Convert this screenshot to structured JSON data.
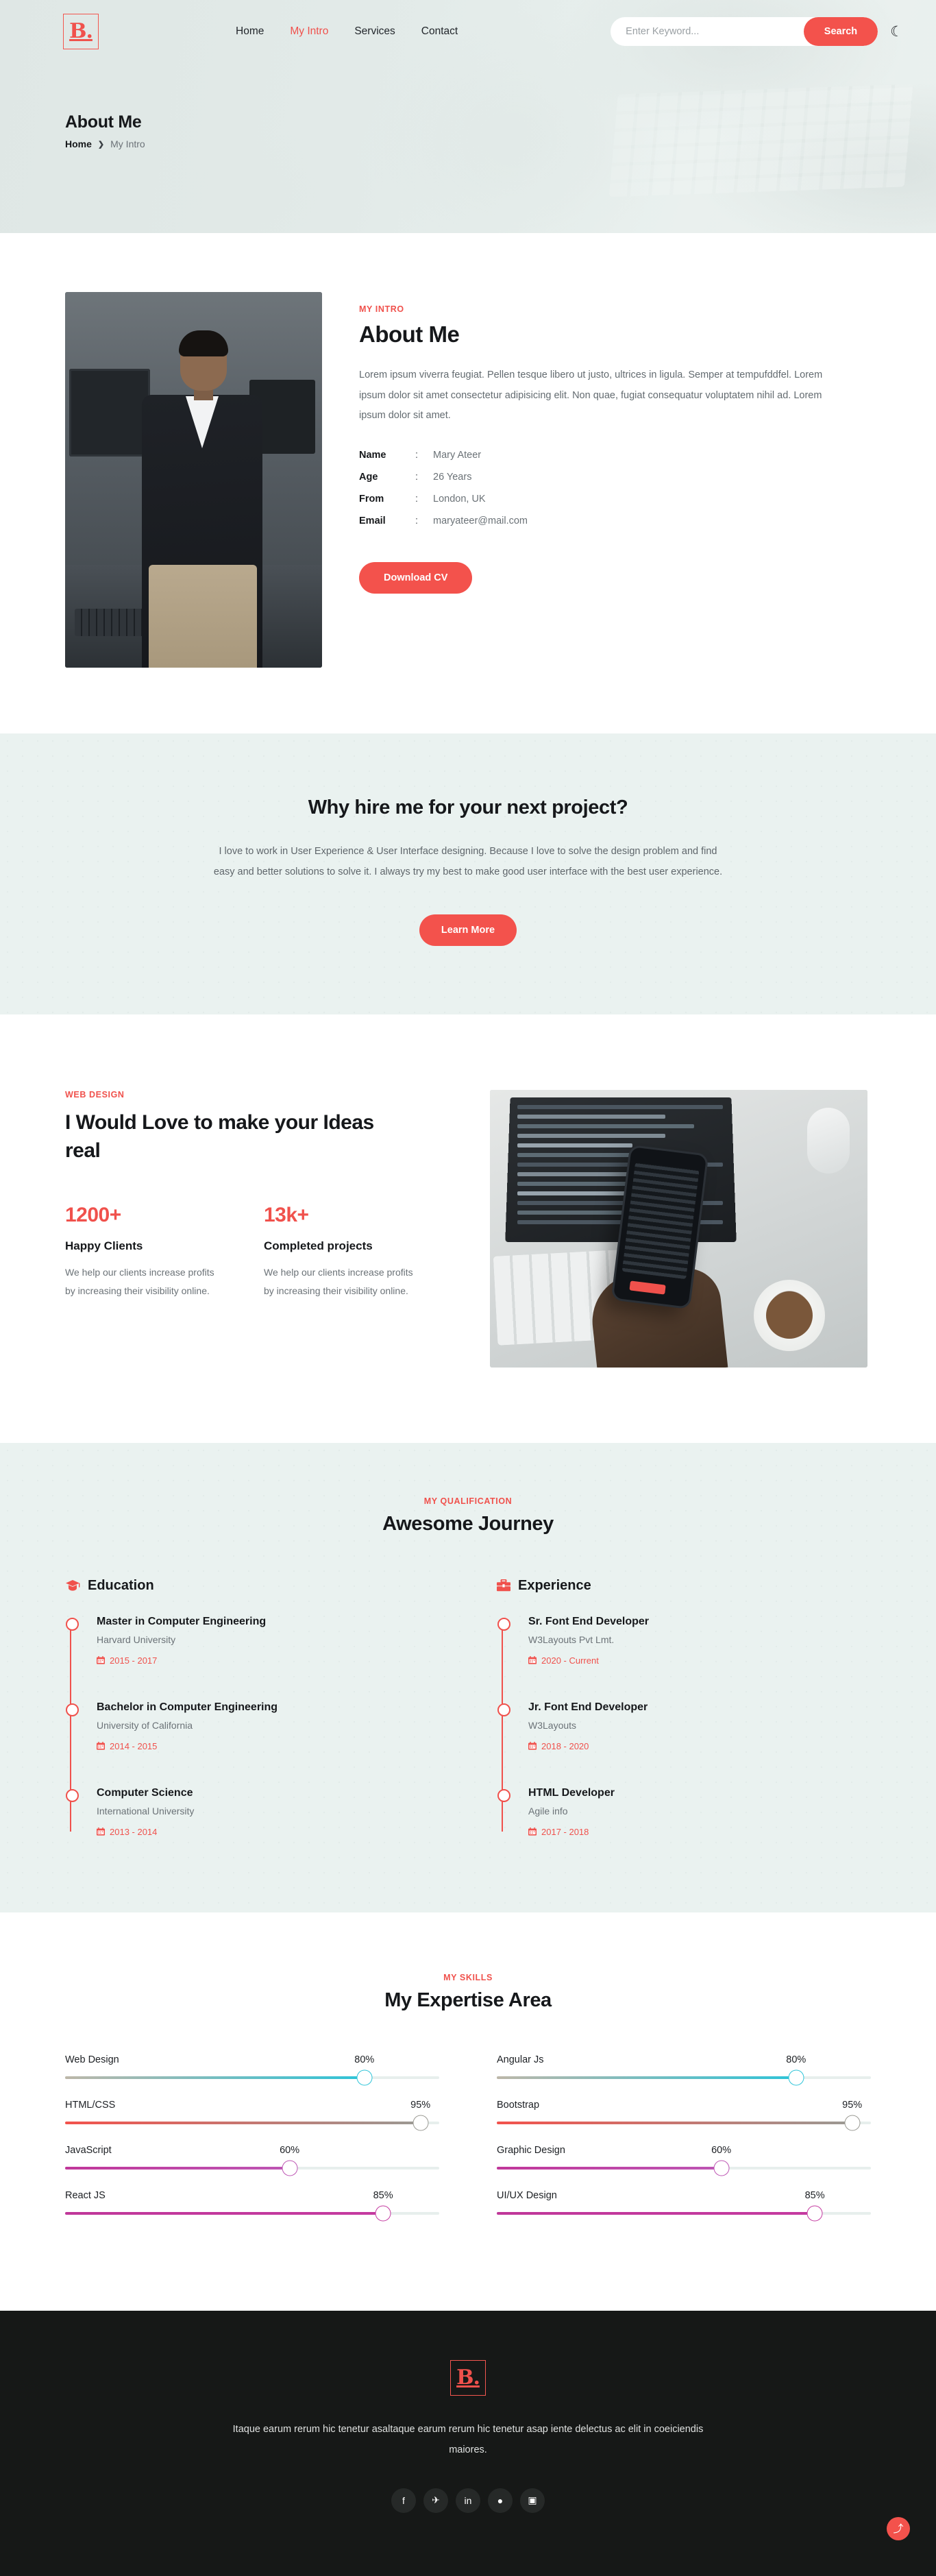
{
  "brand": {
    "logo_text": "B.",
    "logo_icon": "brand-b-logo"
  },
  "nav": {
    "items": [
      {
        "label": "Home",
        "active": false
      },
      {
        "label": "My Intro",
        "active": true
      },
      {
        "label": "Services",
        "active": false
      },
      {
        "label": "Contact",
        "active": false
      }
    ]
  },
  "search": {
    "placeholder": "Enter Keyword...",
    "value": "",
    "button_label": "Search"
  },
  "theme_toggle": {
    "icon": "moon-icon"
  },
  "hero": {
    "title": "About Me",
    "breadcrumb": {
      "home": "Home",
      "separator": "❯",
      "current": "My Intro"
    }
  },
  "about": {
    "eyebrow": "MY INTRO",
    "heading": "About Me",
    "paragraph": "Lorem ipsum viverra feugiat. Pellen tesque libero ut justo, ultrices in ligula. Semper at tempufddfel. Lorem ipsum dolor sit amet consectetur adipisicing elit. Non quae, fugiat consequatur voluptatem nihil ad. Lorem ipsum dolor sit amet.",
    "info": [
      {
        "key": "Name",
        "sep": ":",
        "value": "Mary Ateer"
      },
      {
        "key": "Age",
        "sep": ":",
        "value": "26 Years"
      },
      {
        "key": "From",
        "sep": ":",
        "value": "London, UK"
      },
      {
        "key": "Email",
        "sep": ":",
        "value": "maryateer@mail.com"
      }
    ],
    "cta": "Download CV",
    "photo_alt": "portrait-photo"
  },
  "why_hire": {
    "heading": "Why hire me for your next project?",
    "paragraph": "I love to work in User Experience & User Interface designing. Because I love to solve the design problem and find easy and better solutions to solve it. I always try my best to make good user interface with the best user experience.",
    "cta": "Learn More"
  },
  "ideas": {
    "eyebrow": "WEB DESIGN",
    "heading": "I Would Love to make your Ideas real",
    "stats": [
      {
        "number": "1200+",
        "label": "Happy Clients",
        "desc": "We help our clients increase profits by increasing their visibility online."
      },
      {
        "number": "13k+",
        "label": "Completed projects",
        "desc": "We help our clients increase profits by increasing their visibility online."
      }
    ],
    "image_alt": "laptop-phone-desk-photo"
  },
  "qualification": {
    "eyebrow": "MY QUALIFICATION",
    "heading": "Awesome Journey",
    "education": {
      "title": "Education",
      "icon": "graduation-cap-icon",
      "items": [
        {
          "title": "Master in Computer Engineering",
          "sub": "Harvard University",
          "date": "2015 - 2017"
        },
        {
          "title": "Bachelor in Computer Engineering",
          "sub": "University of California",
          "date": "2014 - 2015"
        },
        {
          "title": "Computer Science",
          "sub": "International University",
          "date": "2013 - 2014"
        }
      ]
    },
    "experience": {
      "title": "Experience",
      "icon": "briefcase-icon",
      "items": [
        {
          "title": "Sr. Font End Developer",
          "sub": "W3Layouts Pvt Lmt.",
          "date": "2020 - Current"
        },
        {
          "title": "Jr. Font End Developer",
          "sub": "W3Layouts",
          "date": "2018 - 2020"
        },
        {
          "title": "HTML Developer",
          "sub": "Agile info",
          "date": "2017 - 2018"
        }
      ]
    }
  },
  "skills": {
    "eyebrow": "MY SKILLS",
    "heading": "My Expertise Area",
    "left": [
      {
        "name": "Web Design",
        "percent": "80%",
        "value": 80,
        "color_from": "#bdb7a9",
        "color_to": "#2ec4d8"
      },
      {
        "name": "HTML/CSS",
        "percent": "95%",
        "value": 95,
        "color_from": "#f3524c",
        "color_to": "#9a9a94"
      },
      {
        "name": "JavaScript",
        "percent": "60%",
        "value": 60,
        "color_from": "#c0379a",
        "color_to": "#bd56b4"
      },
      {
        "name": "React JS",
        "percent": "85%",
        "value": 85,
        "color_from": "#c0379a",
        "color_to": "#c43aa0"
      }
    ],
    "right": [
      {
        "name": "Angular Js",
        "percent": "80%",
        "value": 80,
        "color_from": "#bdb7a9",
        "color_to": "#2ec4d8"
      },
      {
        "name": "Bootstrap",
        "percent": "95%",
        "value": 95,
        "color_from": "#f3524c",
        "color_to": "#9a9a94"
      },
      {
        "name": "Graphic Design",
        "percent": "60%",
        "value": 60,
        "color_from": "#c0379a",
        "color_to": "#bd56b4"
      },
      {
        "name": "UI/UX Design",
        "percent": "85%",
        "value": 85,
        "color_from": "#c0379a",
        "color_to": "#c43aa0"
      }
    ]
  },
  "footer": {
    "logo_text": "B.",
    "text": "Itaque earum rerum hic tenetur asaltaque earum rerum hic tenetur asap iente delectus ac elit in coeiciendis maiores.",
    "socials": [
      {
        "name": "facebook-icon",
        "glyph": "f"
      },
      {
        "name": "twitter-icon",
        "glyph": "✈"
      },
      {
        "name": "linkedin-icon",
        "glyph": "in"
      },
      {
        "name": "dribbble-icon",
        "glyph": "●"
      },
      {
        "name": "instagram-icon",
        "glyph": "▣"
      }
    ],
    "back_to_top": {
      "icon": "arrow-up-icon",
      "glyph": "⤴"
    }
  },
  "colors": {
    "accent": "#f3524c",
    "dark": "#161817",
    "mint": "#eaf2f0"
  }
}
